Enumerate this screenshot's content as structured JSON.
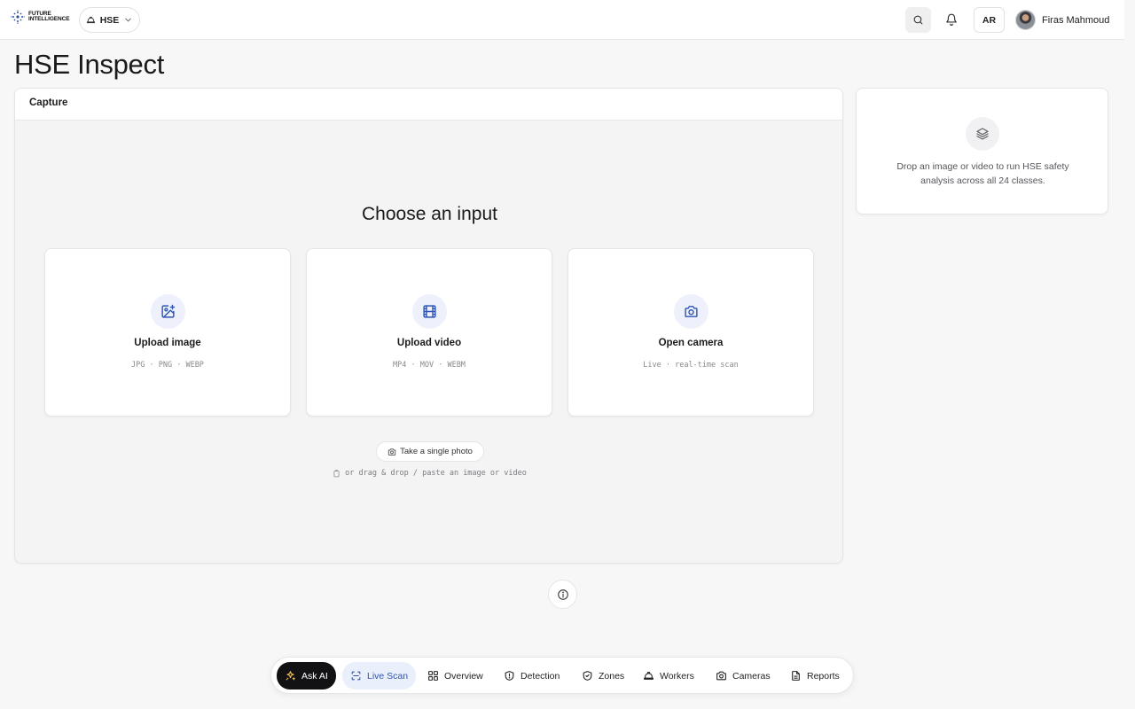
{
  "header": {
    "logo_line1": "FUTURE",
    "logo_line2": "INTELLIGENCE",
    "workspace": "HSE",
    "language": "AR",
    "user_name": "Firas Mahmoud"
  },
  "page_title": "HSE Inspect",
  "capture": {
    "header": "Capture",
    "heading": "Choose an input",
    "options": [
      {
        "title": "Upload image",
        "subtitle": "JPG · PNG · WEBP",
        "icon": "image-plus-icon"
      },
      {
        "title": "Upload video",
        "subtitle": "MP4 · MOV · WEBM",
        "icon": "film-icon"
      },
      {
        "title": "Open camera",
        "subtitle": "Live · real-time scan",
        "icon": "camera-icon"
      }
    ],
    "photo_button": "Take a single photo",
    "drop_hint": "or drag & drop / paste an image or video"
  },
  "info_card": {
    "text": "Drop an image or video to run HSE safety analysis across all 24 classes."
  },
  "bottom_nav": {
    "items": [
      {
        "label": "Ask AI",
        "icon": "sparkle-icon"
      },
      {
        "label": "Live Scan",
        "icon": "scan-icon"
      },
      {
        "label": "Overview",
        "icon": "grid-icon"
      },
      {
        "label": "Detection",
        "icon": "shield-icon"
      },
      {
        "label": "Zones",
        "icon": "shield-check-icon"
      },
      {
        "label": "Workers",
        "icon": "hardhat-icon"
      },
      {
        "label": "Cameras",
        "icon": "camera-icon"
      },
      {
        "label": "Reports",
        "icon": "document-icon"
      }
    ]
  },
  "colors": {
    "accent": "#2d55b5",
    "ask_ai_bg": "#121214",
    "page_bg": "#f7f7f7"
  }
}
